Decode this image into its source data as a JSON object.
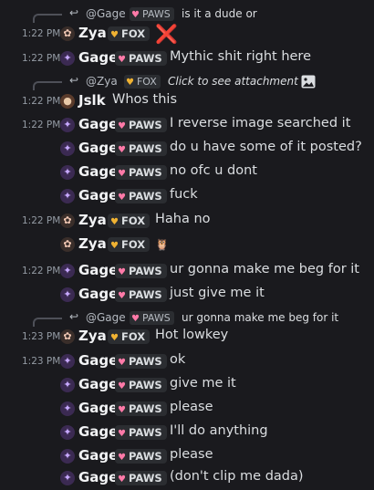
{
  "icons": {
    "reply": "reply-arrow-icon",
    "heart": "heart-icon",
    "gage_avatar": "gage-avatar-icon",
    "zya_avatar": "zya-avatar-icon",
    "jslk_avatar": "jslk-avatar-icon",
    "image": "image-icon",
    "cross": "cross-mark-icon",
    "owl": "owl-icon"
  },
  "colors": {
    "background": "#1a1a1e",
    "paws_heart": "#ff7aa8",
    "fox_heart": "#f0b232",
    "cross_mark": "#e03e3e"
  },
  "replies": [
    {
      "name": "@Gage",
      "tag": "PAWS",
      "text": "is it a dude or"
    },
    {
      "name": "@Zya",
      "tag": "FOX",
      "text": "Click to see attachment"
    },
    {
      "name": "@Gage",
      "tag": "PAWS",
      "text": "ur gonna make me beg for it"
    }
  ],
  "messages": [
    {
      "time": "1:22 PM",
      "user": "Zya",
      "tag": "FOX",
      "text": "❌"
    },
    {
      "time": "1:22 PM",
      "user": "Gage",
      "tag": "PAWS",
      "text": "Mythic shit right here"
    },
    {
      "time": "1:22 PM",
      "user": "Jslk",
      "text": "Whos this"
    },
    {
      "time": "1:22 PM",
      "user": "Gage",
      "tag": "PAWS",
      "text": "I reverse image searched it"
    },
    {
      "user": "Gage",
      "tag": "PAWS",
      "text": "do u have some of it posted?"
    },
    {
      "user": "Gage",
      "tag": "PAWS",
      "text": "no ofc u dont"
    },
    {
      "user": "Gage",
      "tag": "PAWS",
      "text": "fuck"
    },
    {
      "time": "1:22 PM",
      "user": "Zya",
      "tag": "FOX",
      "text": "Haha no"
    },
    {
      "user": "Zya",
      "tag": "FOX",
      "text": "🦉"
    },
    {
      "time": "1:22 PM",
      "user": "Gage",
      "tag": "PAWS",
      "text": "ur gonna make me beg for it"
    },
    {
      "user": "Gage",
      "tag": "PAWS",
      "text": "just give me it"
    },
    {
      "time": "1:23 PM",
      "user": "Zya",
      "tag": "FOX",
      "text": "Hot lowkey"
    },
    {
      "time": "1:23 PM",
      "user": "Gage",
      "tag": "PAWS",
      "text": "ok"
    },
    {
      "user": "Gage",
      "tag": "PAWS",
      "text": "give me it"
    },
    {
      "user": "Gage",
      "tag": "PAWS",
      "text": "please"
    },
    {
      "user": "Gage",
      "tag": "PAWS",
      "text": "I'll do anything"
    },
    {
      "user": "Gage",
      "tag": "PAWS",
      "text": "please"
    },
    {
      "user": "Gage",
      "tag": "PAWS",
      "text": "(don't clip me dada)"
    }
  ]
}
